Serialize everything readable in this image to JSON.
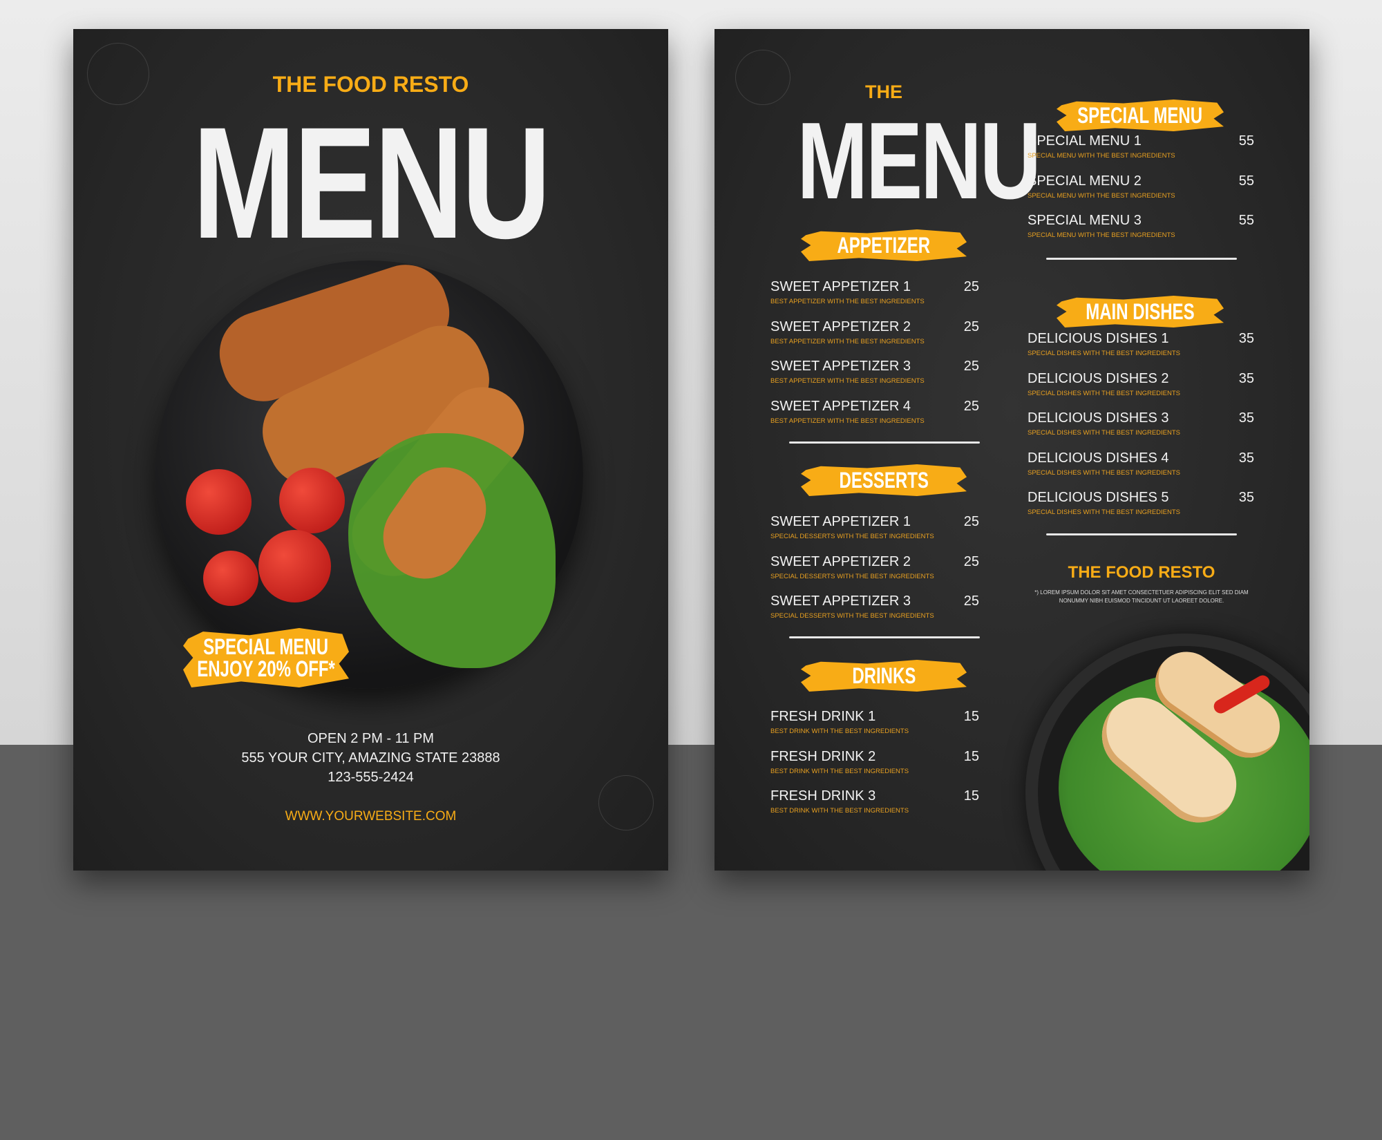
{
  "cover": {
    "brand": "THE FOOD RESTO",
    "title": "MENU",
    "promo_line1": "SPECIAL MENU",
    "promo_line2": "ENJOY 20% OFF*",
    "hours": "OPEN 2 PM - 11 PM",
    "address": "555 YOUR CITY, AMAZING STATE 23888",
    "phone": "123-555-2424",
    "website": "WWW.YOURWEBSITE.COM"
  },
  "inside": {
    "the": "THE",
    "title": "MENU",
    "appetizer": {
      "heading": "APPETIZER",
      "items": [
        {
          "name": "SWEET APPETIZER 1",
          "desc": "BEST APPETIZER WITH THE BEST INGREDIENTS",
          "price": "25"
        },
        {
          "name": "SWEET APPETIZER 2",
          "desc": "BEST APPETIZER WITH THE BEST INGREDIENTS",
          "price": "25"
        },
        {
          "name": "SWEET APPETIZER 3",
          "desc": "BEST APPETIZER WITH THE BEST INGREDIENTS",
          "price": "25"
        },
        {
          "name": "SWEET APPETIZER 4",
          "desc": "BEST APPETIZER WITH THE BEST INGREDIENTS",
          "price": "25"
        }
      ]
    },
    "desserts": {
      "heading": "DESSERTS",
      "items": [
        {
          "name": "SWEET APPETIZER 1",
          "desc": "SPECIAL DESSERTS WITH THE BEST INGREDIENTS",
          "price": "25"
        },
        {
          "name": "SWEET APPETIZER 2",
          "desc": "SPECIAL DESSERTS WITH THE BEST INGREDIENTS",
          "price": "25"
        },
        {
          "name": "SWEET APPETIZER 3",
          "desc": "SPECIAL DESSERTS WITH THE BEST INGREDIENTS",
          "price": "25"
        }
      ]
    },
    "drinks": {
      "heading": "DRINKS",
      "items": [
        {
          "name": "FRESH DRINK 1",
          "desc": "BEST DRINK WITH THE BEST INGREDIENTS",
          "price": "15"
        },
        {
          "name": "FRESH DRINK 2",
          "desc": "BEST DRINK WITH THE BEST INGREDIENTS",
          "price": "15"
        },
        {
          "name": "FRESH DRINK 3",
          "desc": "BEST DRINK WITH THE BEST INGREDIENTS",
          "price": "15"
        }
      ]
    },
    "special": {
      "heading": "SPECIAL MENU",
      "items": [
        {
          "name": "SPECIAL MENU 1",
          "desc": "SPECIAL MENU WITH THE BEST INGREDIENTS",
          "price": "55"
        },
        {
          "name": "SPECIAL MENU 2",
          "desc": "SPECIAL MENU WITH THE BEST INGREDIENTS",
          "price": "55"
        },
        {
          "name": "SPECIAL MENU 3",
          "desc": "SPECIAL MENU WITH THE BEST INGREDIENTS",
          "price": "55"
        }
      ]
    },
    "main": {
      "heading": "MAIN DISHES",
      "items": [
        {
          "name": "DELICIOUS DISHES 1",
          "desc": "SPECIAL DISHES WITH THE BEST INGREDIENTS",
          "price": "35"
        },
        {
          "name": "DELICIOUS DISHES 2",
          "desc": "SPECIAL DISHES WITH THE BEST INGREDIENTS",
          "price": "35"
        },
        {
          "name": "DELICIOUS DISHES 3",
          "desc": "SPECIAL DISHES WITH THE BEST INGREDIENTS",
          "price": "35"
        },
        {
          "name": "DELICIOUS DISHES 4",
          "desc": "SPECIAL DISHES WITH THE BEST INGREDIENTS",
          "price": "35"
        },
        {
          "name": "DELICIOUS DISHES 5",
          "desc": "SPECIAL DISHES WITH THE BEST INGREDIENTS",
          "price": "35"
        }
      ]
    },
    "footer_brand": "THE FOOD RESTO",
    "footnote_line1": "*) LOREM IPSUM DOLOR SIT AMET CONSECTETUER ADIPISCING ELIT SED DIAM",
    "footnote_line2": "NONUMMY NIBH EUISMOD TINCIDUNT UT LAOREET DOLORE."
  },
  "colors": {
    "accent": "#f8ac16",
    "page": "#262626"
  }
}
